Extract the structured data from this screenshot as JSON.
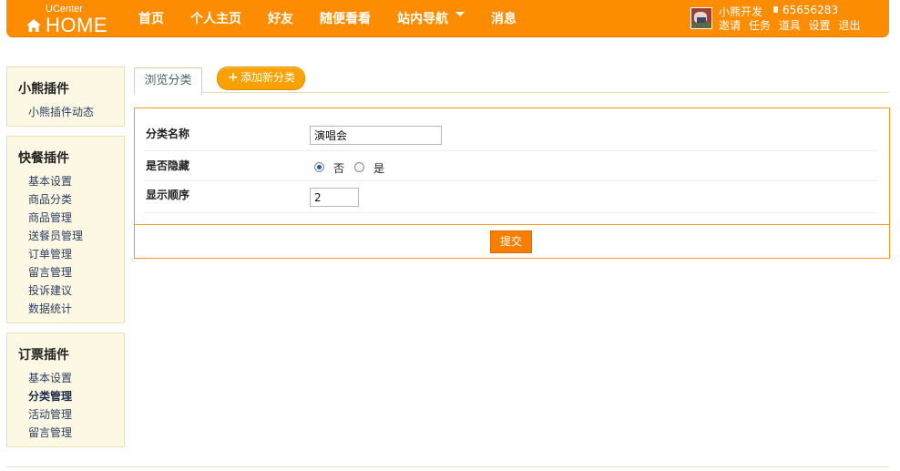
{
  "brand": {
    "small": "UCenter",
    "big": "HOME"
  },
  "nav": [
    {
      "label": "首页"
    },
    {
      "label": "个人主页"
    },
    {
      "label": "好友"
    },
    {
      "label": "随便看看"
    },
    {
      "label": "站内导航"
    },
    {
      "label": "消息"
    }
  ],
  "user": {
    "name": "小熊开发",
    "credit": "65656283",
    "links": [
      "邀请",
      "任务",
      "道具",
      "设置",
      "退出"
    ]
  },
  "sidebar": [
    {
      "title": "小熊插件",
      "items": [
        {
          "label": "小熊插件动态"
        }
      ]
    },
    {
      "title": "快餐插件",
      "items": [
        {
          "label": "基本设置"
        },
        {
          "label": "商品分类"
        },
        {
          "label": "商品管理"
        },
        {
          "label": "送餐员管理"
        },
        {
          "label": "订单管理"
        },
        {
          "label": "留言管理"
        },
        {
          "label": "投诉建议"
        },
        {
          "label": "数据统计"
        }
      ]
    },
    {
      "title": "订票插件",
      "items": [
        {
          "label": "基本设置"
        },
        {
          "label": "分类管理",
          "active": true
        },
        {
          "label": "活动管理"
        },
        {
          "label": "留言管理"
        }
      ]
    }
  ],
  "tabs": {
    "browse": "浏览分类",
    "add": "添加新分类"
  },
  "form": {
    "name_label": "分类名称",
    "name_value": "演唱会",
    "hidden_label": "是否隐藏",
    "hidden_options": [
      {
        "label": "否",
        "checked": true
      },
      {
        "label": "是",
        "checked": false
      }
    ],
    "order_label": "显示顺序",
    "order_value": "2",
    "submit": "提交"
  },
  "colors": {
    "brand_orange": "#fe8c00",
    "sidebar_bg": "#fcf8e3",
    "panel_border": "#f39a1f"
  },
  "icons": {
    "logo": "house-icon",
    "nav_more": "caret-down-icon",
    "credit": "coin-icon",
    "add": "plus-icon"
  }
}
